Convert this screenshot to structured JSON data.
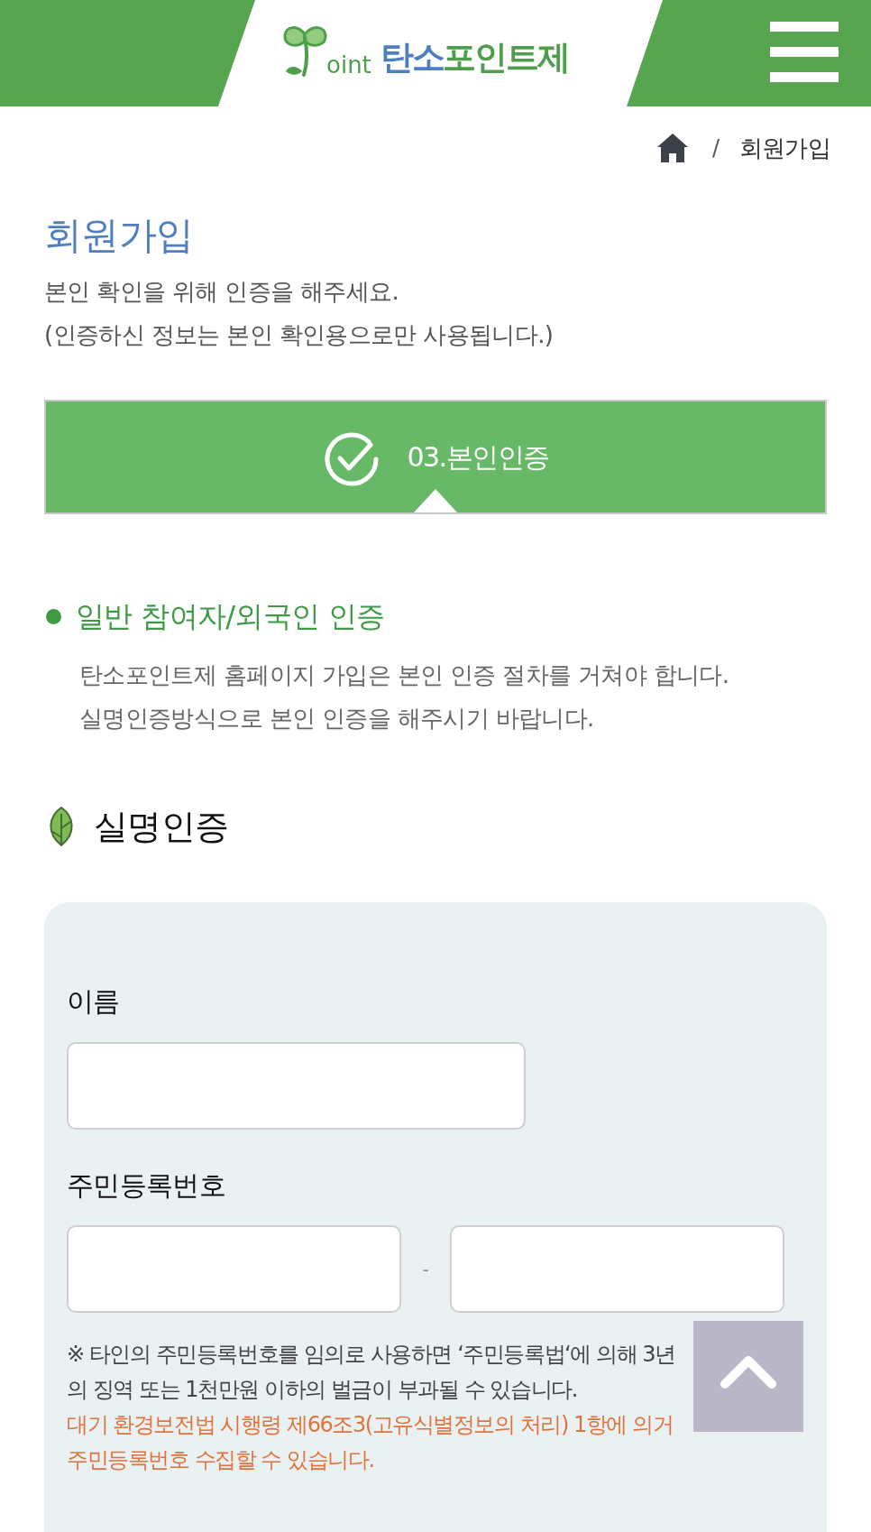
{
  "header": {
    "logo": {
      "mark_text": "oint",
      "name_lead": "탄소",
      "name_rest": "포인트제"
    }
  },
  "breadcrumb": {
    "separator": "/",
    "current": "회원가입"
  },
  "intro": {
    "title": "회원가입",
    "lines": [
      "본인 확인을 위해 인증을 해주세요.",
      "(인증하신 정보는 본인 확인용으로만 사용됩니다.)"
    ]
  },
  "step": {
    "label": "03.본인인증"
  },
  "notice": {
    "heading": "일반 참여자/외국인 인증",
    "lines": [
      "탄소포인트제 홈페이지 가입은 본인 인증 절차를 거쳐야 합니다.",
      "실명인증방식으로 본인 인증을 해주시기 바랍니다."
    ]
  },
  "form": {
    "title": "실명인증",
    "fields": [
      {
        "label": "이름",
        "kind": "single"
      },
      {
        "label": "주민등록번호",
        "kind": "split",
        "separator": "-"
      }
    ],
    "warning_lines": [
      "※ 타인의 주민등록번호를 임의로 사용하면 ‘주민등록법‘에 의해 3년",
      "의 징역 또는 1천만원 이하의 벌금이 부과될 수 있습니다."
    ],
    "legal_lines": [
      "대기 환경보전법 시행령 제66조3(고유식별정보의 처리) 1항에 의거",
      "주민등록번호 수집할 수 있습니다."
    ]
  }
}
